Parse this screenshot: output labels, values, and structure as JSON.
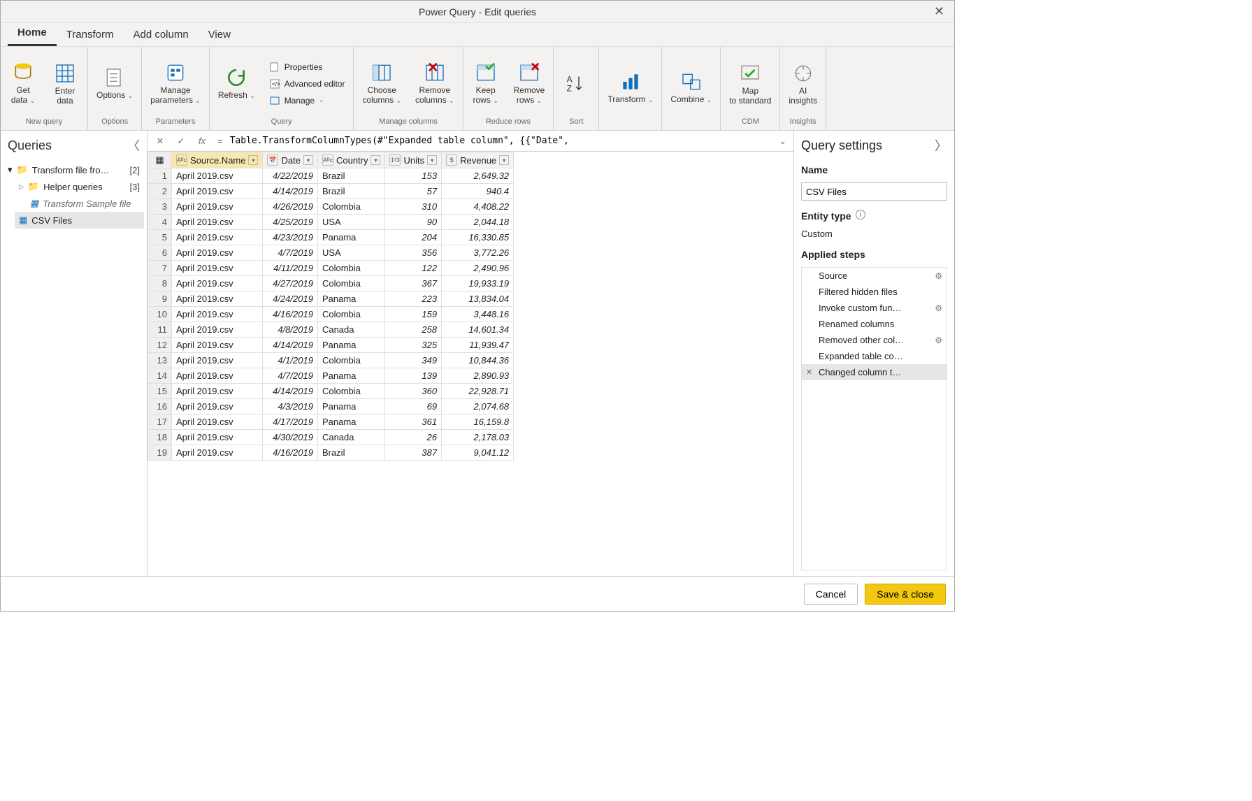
{
  "window": {
    "title": "Power Query - Edit queries"
  },
  "tabs": [
    "Home",
    "Transform",
    "Add column",
    "View"
  ],
  "active_tab": 0,
  "ribbon": {
    "groups": [
      {
        "label": "New query",
        "big": [
          {
            "label": "Get data",
            "icon": "database",
            "chev": true
          },
          {
            "label": "Enter data",
            "icon": "grid",
            "chev": false
          }
        ]
      },
      {
        "label": "Options",
        "big": [
          {
            "label": "Options",
            "icon": "list",
            "chev": true
          }
        ]
      },
      {
        "label": "Parameters",
        "big": [
          {
            "label": "Manage parameters",
            "icon": "params",
            "chev": true
          }
        ]
      },
      {
        "label": "Query",
        "big": [
          {
            "label": "Refresh",
            "icon": "refresh",
            "chev": true
          }
        ],
        "small": [
          {
            "label": "Properties",
            "icon": "prop"
          },
          {
            "label": "Advanced editor",
            "icon": "adv"
          },
          {
            "label": "Manage",
            "icon": "manage",
            "chev": true
          }
        ]
      },
      {
        "label": "Manage columns",
        "big": [
          {
            "label": "Choose columns",
            "icon": "choose",
            "chev": true
          },
          {
            "label": "Remove columns",
            "icon": "remove",
            "chev": true
          }
        ]
      },
      {
        "label": "Reduce rows",
        "big": [
          {
            "label": "Keep rows",
            "icon": "keep",
            "chev": true
          },
          {
            "label": "Remove rows",
            "icon": "removerows",
            "chev": true
          }
        ]
      },
      {
        "label": "Sort",
        "big": [
          {
            "label": "",
            "icon": "sort",
            "chev": false
          }
        ]
      },
      {
        "label": "",
        "big": [
          {
            "label": "Transform",
            "icon": "transform",
            "chev": true
          }
        ]
      },
      {
        "label": "",
        "big": [
          {
            "label": "Combine",
            "icon": "combine",
            "chev": true
          }
        ]
      },
      {
        "label": "CDM",
        "big": [
          {
            "label": "Map to standard",
            "icon": "cdm",
            "chev": false
          }
        ]
      },
      {
        "label": "Insights",
        "big": [
          {
            "label": "AI insights",
            "icon": "ai",
            "chev": false
          }
        ]
      }
    ]
  },
  "queries_panel": {
    "title": "Queries",
    "root": {
      "name": "Transform file fro…",
      "count": "[2]"
    },
    "helper": {
      "name": "Helper queries",
      "count": "[3]"
    },
    "sample": "Transform Sample file",
    "selected": "CSV Files"
  },
  "formula": "Table.TransformColumnTypes(#\"Expanded table column\", {{\"Date\",",
  "columns": [
    {
      "name": "Source.Name",
      "type": "text",
      "selected": true
    },
    {
      "name": "Date",
      "type": "date"
    },
    {
      "name": "Country",
      "type": "text"
    },
    {
      "name": "Units",
      "type": "int"
    },
    {
      "name": "Revenue",
      "type": "money"
    }
  ],
  "rows": [
    [
      "April 2019.csv",
      "4/22/2019",
      "Brazil",
      "153",
      "2,649.32"
    ],
    [
      "April 2019.csv",
      "4/14/2019",
      "Brazil",
      "57",
      "940.4"
    ],
    [
      "April 2019.csv",
      "4/26/2019",
      "Colombia",
      "310",
      "4,408.22"
    ],
    [
      "April 2019.csv",
      "4/25/2019",
      "USA",
      "90",
      "2,044.18"
    ],
    [
      "April 2019.csv",
      "4/23/2019",
      "Panama",
      "204",
      "16,330.85"
    ],
    [
      "April 2019.csv",
      "4/7/2019",
      "USA",
      "356",
      "3,772.26"
    ],
    [
      "April 2019.csv",
      "4/11/2019",
      "Colombia",
      "122",
      "2,490.96"
    ],
    [
      "April 2019.csv",
      "4/27/2019",
      "Colombia",
      "367",
      "19,933.19"
    ],
    [
      "April 2019.csv",
      "4/24/2019",
      "Panama",
      "223",
      "13,834.04"
    ],
    [
      "April 2019.csv",
      "4/16/2019",
      "Colombia",
      "159",
      "3,448.16"
    ],
    [
      "April 2019.csv",
      "4/8/2019",
      "Canada",
      "258",
      "14,601.34"
    ],
    [
      "April 2019.csv",
      "4/14/2019",
      "Panama",
      "325",
      "11,939.47"
    ],
    [
      "April 2019.csv",
      "4/1/2019",
      "Colombia",
      "349",
      "10,844.36"
    ],
    [
      "April 2019.csv",
      "4/7/2019",
      "Panama",
      "139",
      "2,890.93"
    ],
    [
      "April 2019.csv",
      "4/14/2019",
      "Colombia",
      "360",
      "22,928.71"
    ],
    [
      "April 2019.csv",
      "4/3/2019",
      "Panama",
      "69",
      "2,074.68"
    ],
    [
      "April 2019.csv",
      "4/17/2019",
      "Panama",
      "361",
      "16,159.8"
    ],
    [
      "April 2019.csv",
      "4/30/2019",
      "Canada",
      "26",
      "2,178.03"
    ],
    [
      "April 2019.csv",
      "4/16/2019",
      "Brazil",
      "387",
      "9,041.12"
    ]
  ],
  "settings": {
    "title": "Query settings",
    "name_label": "Name",
    "name_value": "CSV Files",
    "entity_label": "Entity type",
    "entity_value": "Custom",
    "steps_label": "Applied steps",
    "steps": [
      {
        "name": "Source",
        "gear": true
      },
      {
        "name": "Filtered hidden files"
      },
      {
        "name": "Invoke custom fun…",
        "gear": true
      },
      {
        "name": "Renamed columns"
      },
      {
        "name": "Removed other col…",
        "gear": true
      },
      {
        "name": "Expanded table co…"
      },
      {
        "name": "Changed column t…",
        "selected": true,
        "del": true
      }
    ]
  },
  "footer": {
    "cancel": "Cancel",
    "save": "Save & close"
  },
  "type_icons": {
    "text": "Aᴮc",
    "date": "📅",
    "int": "1²3",
    "money": "$"
  }
}
